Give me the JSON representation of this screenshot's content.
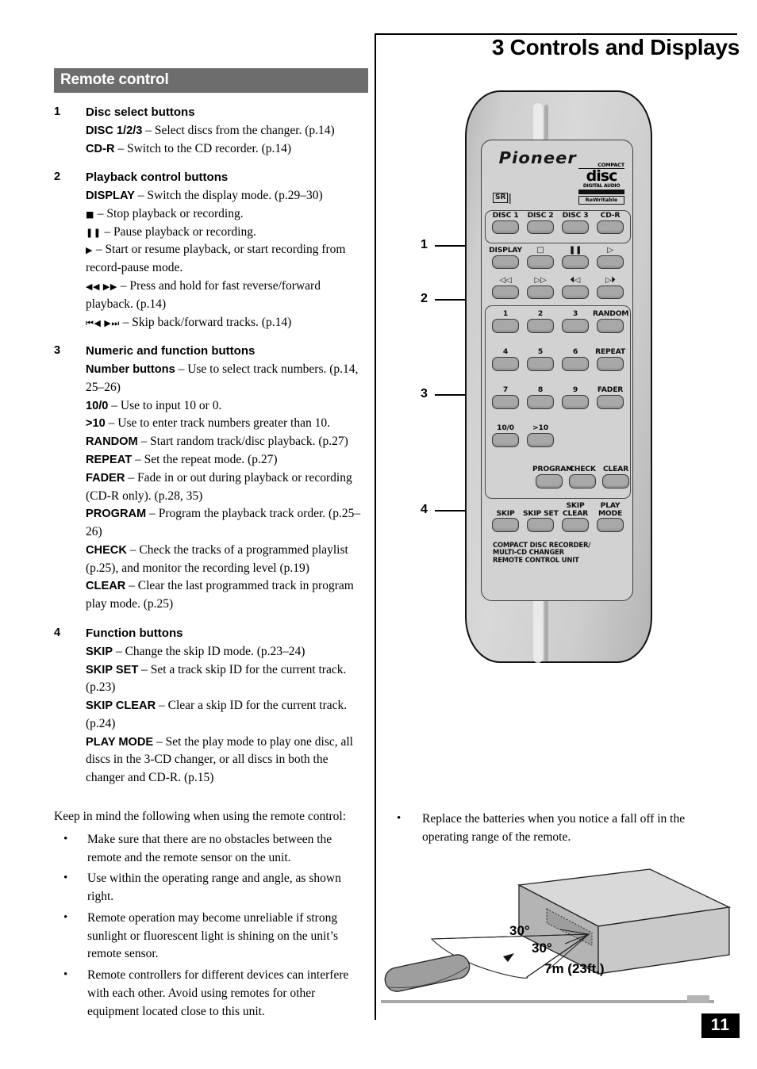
{
  "chapter": {
    "title": "3 Controls and Displays"
  },
  "left": {
    "section_title": "Remote control",
    "items": [
      {
        "num": "1",
        "heading": "Disc select buttons",
        "lines": [
          {
            "bold": "DISC 1/2/3",
            "rest": " – Select discs from the changer. (p.14)"
          },
          {
            "bold": "CD-R",
            "rest": " – Switch to the CD recorder. (p.14)"
          }
        ]
      },
      {
        "num": "2",
        "heading": "Playback control buttons",
        "lines": [
          {
            "bold": "DISPLAY",
            "rest": " – Switch the display mode. (p.29–30)"
          },
          {
            "glyph": "■",
            "rest": " – Stop playback or recording."
          },
          {
            "glyph": "❚❚",
            "rest": " – Pause playback or recording."
          },
          {
            "glyph": "▶",
            "rest": " – Start or resume playback, or start recording from record-pause mode."
          },
          {
            "glyph": "◀◀ ▶▶",
            "rest": "  – Press and hold for fast reverse/forward playback. (p.14)"
          },
          {
            "glyph": "⏮◀ ▶⏭",
            "rest": " – Skip back/forward tracks. (p.14)"
          }
        ]
      },
      {
        "num": "3",
        "heading": "Numeric and function buttons",
        "lines": [
          {
            "bold": "Number buttons",
            "rest": " – Use to select track numbers. (p.14, 25–26)"
          },
          {
            "bold": "10/0",
            "rest": " – Use to input 10 or 0."
          },
          {
            "bold": ">10",
            "rest": " – Use to enter track numbers greater than 10."
          },
          {
            "bold": "RANDOM",
            "rest": " – Start random track/disc playback. (p.27)"
          },
          {
            "bold": "REPEAT",
            "rest": " – Set the repeat mode. (p.27)"
          },
          {
            "bold": "FADER",
            "rest": " – Fade in or out during playback or recording (CD-R only). (p.28, 35)"
          },
          {
            "bold": "PROGRAM",
            "rest": " – Program the playback track order. (p.25–26)"
          },
          {
            "bold": "CHECK",
            "rest": " – Check the tracks of a programmed playlist (p.25), and monitor the recording level (p.19)"
          },
          {
            "bold": "CLEAR",
            "rest": " – Clear the last programmed track in program play mode. (p.25)"
          }
        ]
      },
      {
        "num": "4",
        "heading": "Function buttons",
        "lines": [
          {
            "bold": "SKIP",
            "rest": " – Change the skip ID mode. (p.23–24)"
          },
          {
            "bold": "SKIP SET",
            "rest": " – Set a track skip ID for the current track. (p.23)"
          },
          {
            "bold": "SKIP CLEAR",
            "rest": " – Clear a skip ID for the current track. (p.24)"
          },
          {
            "bold": "PLAY MODE",
            "rest": " – Set the play mode to play one disc, all discs in the 3-CD changer, or all discs in both the changer and CD-R. (p.15)"
          }
        ]
      }
    ],
    "keep_in_mind_intro": "Keep in mind the following when using the remote control:",
    "keep_in_mind_bullets": [
      "Make sure that there are no obstacles between the remote and the remote sensor on the unit.",
      "Use within the operating range and angle, as shown right.",
      "Remote operation may become unreliable if strong sunlight or fluorescent light is shining on the unit’s remote sensor.",
      "Remote controllers for different devices can interfere with each other. Avoid using remotes for other equipment located close to this unit."
    ]
  },
  "right": {
    "bullets": [
      "Replace the batteries when you notice a fall off in the operating range of the remote."
    ]
  },
  "remote": {
    "brand": "Pioneer",
    "sr_badge": "SR",
    "cd_logo": {
      "compact": "COMPACT",
      "disc": "disc",
      "audio": "DIGITAL AUDIO",
      "rewritable": "ReWritable"
    },
    "unit_caption": [
      "COMPACT DISC RECORDER/",
      "MULTI-CD CHANGER",
      "REMOTE CONTROL UNIT"
    ],
    "callouts": [
      "1",
      "2",
      "3",
      "4"
    ],
    "disc_row": [
      "DISC 1",
      "DISC 2",
      "DISC 3",
      "CD-R"
    ],
    "playback_row1": [
      {
        "label": "DISPLAY",
        "type": "text"
      },
      {
        "label": "□",
        "type": "sym"
      },
      {
        "label": "❚❚",
        "type": "sym"
      },
      {
        "label": "▷",
        "type": "sym"
      }
    ],
    "playback_row2": [
      {
        "label": "◁◁",
        "type": "sym"
      },
      {
        "label": "▷▷",
        "type": "sym"
      },
      {
        "label": "⏴◁",
        "type": "sym"
      },
      {
        "label": "▷⏵",
        "type": "sym"
      }
    ],
    "numeric_rows": [
      [
        "1",
        "2",
        "3",
        "RANDOM"
      ],
      [
        "4",
        "5",
        "6",
        "REPEAT"
      ],
      [
        "7",
        "8",
        "9",
        "FADER"
      ],
      [
        "10/0",
        ">10",
        "",
        ""
      ]
    ],
    "program_row": [
      "PROGRAM",
      "CHECK",
      "CLEAR"
    ],
    "function_row": [
      {
        "l1": "SKIP",
        "l2": ""
      },
      {
        "l1": "SKIP SET",
        "l2": ""
      },
      {
        "l1": "SKIP",
        "l2": "CLEAR"
      },
      {
        "l1": "PLAY",
        "l2": "MODE"
      }
    ]
  },
  "range_diagram": {
    "angle_top": "30°",
    "angle_bottom": "30°",
    "distance": "7m (23ft.)"
  },
  "footer": {
    "page_number": "11"
  },
  "colors": {
    "section_bar": "#6d6d6d",
    "remote_face": "#d2d2d2",
    "button": "#a8a8a8",
    "page_badge": "#000000"
  }
}
